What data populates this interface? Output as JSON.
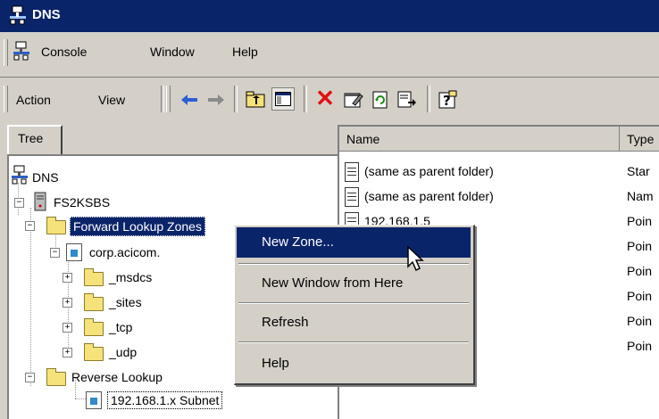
{
  "window": {
    "title": "DNS",
    "icon": "dns-server-icon"
  },
  "menubar": {
    "items": [
      "Console",
      "Window",
      "Help"
    ]
  },
  "toolbar": {
    "action_label": "Action",
    "view_label": "View",
    "icons": [
      "back-arrow-icon",
      "forward-arrow-icon",
      "up-folder-icon",
      "show-hide-tree-icon",
      "delete-icon",
      "properties-icon",
      "refresh-icon",
      "export-list-icon",
      "help-icon"
    ]
  },
  "tree_pane": {
    "tab_label": "Tree",
    "nodes": {
      "root": "DNS",
      "server": "FS2KSBS",
      "forward": "Forward Lookup Zones",
      "zone": "corp.acicom.",
      "msdcs": "_msdcs",
      "sites": "_sites",
      "tcp": "_tcp",
      "udp": "_udp",
      "reverse": "Reverse Lookup",
      "subnet": "192.168.1.x Subnet"
    }
  },
  "list_pane": {
    "columns": [
      "Name",
      "Type"
    ],
    "rows": [
      {
        "name": "(same as parent folder)",
        "type": "Star"
      },
      {
        "name": "(same as parent folder)",
        "type": "Nam"
      },
      {
        "name": "192.168.1.5",
        "type": "Poin"
      },
      {
        "name": "",
        "type": "Poin"
      },
      {
        "name": "",
        "type": "Poin"
      },
      {
        "name": "",
        "type": "Poin"
      },
      {
        "name": "",
        "type": "Poin"
      },
      {
        "name": "",
        "type": "Poin"
      }
    ]
  },
  "context_menu": {
    "items": [
      "New Zone...",
      "New Window from Here",
      "Refresh",
      "Help"
    ],
    "selected": "New Zone..."
  },
  "colors": {
    "titlebar": "#0a246a",
    "selection": "#0a246a",
    "chrome": "#d4d0c8"
  }
}
